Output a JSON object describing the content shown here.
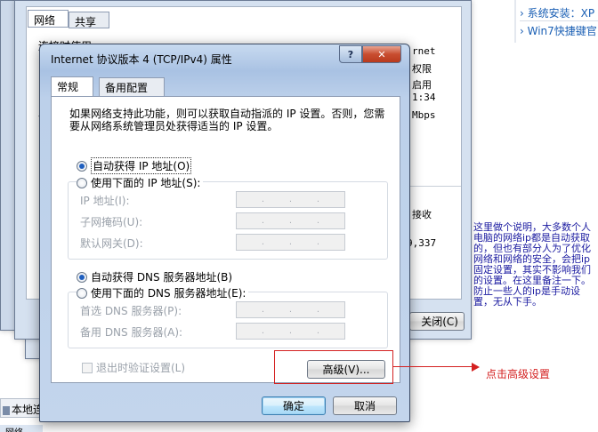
{
  "web": {
    "links": [
      "系统安装：XP",
      "Win7快捷键官"
    ],
    "note": "这里做个说明，大多数个人电脑的网络ip都是自动获取的，但也有部分人为了优化网络和网络的安全，会把ip固定设置，其实不影响我们的设置。在这里备注一下。防止一些人的ip是手动设置，无从下手。",
    "callout": "点击高级设置"
  },
  "bg_window_outer": {
    "tabs": [
      "网络",
      "共享"
    ],
    "partial_label": "连接时使用",
    "partial_label2": "此",
    "right_texts": [
      "rnet",
      "权限",
      "1:34",
      "Mbps",
      "启用",
      "接收",
      "9,337"
    ],
    "close_button": "关闭(C)"
  },
  "taskbar": {
    "item": "本地连",
    "item2": "网络"
  },
  "dialog": {
    "title": "Internet 协议版本 4 (TCP/IPv4) 属性",
    "help_glyph": "?",
    "close_glyph": "✕",
    "tabs": [
      "常规",
      "备用配置"
    ],
    "intro": "如果网络支持此功能，则可以获取自动指派的 IP 设置。否则，您需要从网络系统管理员处获得适当的 IP 设置。",
    "ip_auto": "自动获得 IP 地址(O)",
    "ip_manual": "使用下面的 IP 地址(S):",
    "ip_fields": [
      "IP 地址(I):",
      "子网掩码(U):",
      "默认网关(D):"
    ],
    "dns_auto": "自动获得 DNS 服务器地址(B)",
    "dns_manual": "使用下面的 DNS 服务器地址(E):",
    "dns_fields": [
      "首选 DNS 服务器(P):",
      "备用 DNS 服务器(A):"
    ],
    "ip_dots": ".",
    "validate": "退出时验证设置(L)",
    "advanced": "高级(V)...",
    "ok": "确定",
    "cancel": "取消"
  }
}
